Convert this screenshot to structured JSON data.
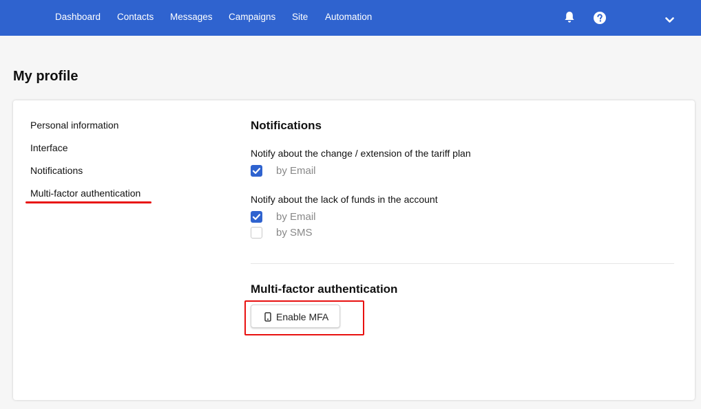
{
  "nav": {
    "items": [
      {
        "label": "Dashboard"
      },
      {
        "label": "Contacts"
      },
      {
        "label": "Messages"
      },
      {
        "label": "Campaigns"
      },
      {
        "label": "Site"
      },
      {
        "label": "Automation"
      }
    ],
    "icons": [
      "bell-icon",
      "help-icon",
      "chevron-down-icon"
    ]
  },
  "page": {
    "title": "My profile"
  },
  "sidebar": {
    "items": [
      {
        "label": "Personal information"
      },
      {
        "label": "Interface"
      },
      {
        "label": "Notifications"
      },
      {
        "label": "Multi-factor authentication",
        "active": true
      }
    ]
  },
  "notifications": {
    "title": "Notifications",
    "groups": [
      {
        "label": "Notify about the change / extension of the tariff plan",
        "options": [
          {
            "label": "by Email",
            "checked": true
          }
        ]
      },
      {
        "label": "Notify about the lack of funds in the account",
        "options": [
          {
            "label": "by Email",
            "checked": true
          },
          {
            "label": "by SMS",
            "checked": false
          }
        ]
      }
    ]
  },
  "mfa": {
    "title": "Multi-factor authentication",
    "button_label": "Enable MFA",
    "button_icon": "phone-icon"
  },
  "colors": {
    "header": "#2f63cf",
    "accent": "#2f63cf",
    "highlight": "#e8100f"
  }
}
